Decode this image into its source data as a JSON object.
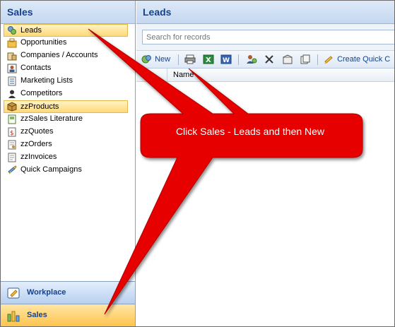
{
  "sidebar": {
    "title": "Sales",
    "items": [
      {
        "label": "Leads",
        "icon": "leads-icon",
        "selected": true
      },
      {
        "label": "Opportunities",
        "icon": "opportunities-icon",
        "selected": false
      },
      {
        "label": "Companies / Accounts",
        "icon": "accounts-icon",
        "selected": false
      },
      {
        "label": "Contacts",
        "icon": "contacts-icon",
        "selected": false
      },
      {
        "label": "Marketing Lists",
        "icon": "marketing-lists-icon",
        "selected": false
      },
      {
        "label": "Competitors",
        "icon": "competitors-icon",
        "selected": false
      },
      {
        "label": "zzProducts",
        "icon": "products-icon",
        "selected": true
      },
      {
        "label": "zzSales Literature",
        "icon": "sales-literature-icon",
        "selected": false
      },
      {
        "label": "zzQuotes",
        "icon": "quotes-icon",
        "selected": false
      },
      {
        "label": "zzOrders",
        "icon": "orders-icon",
        "selected": false
      },
      {
        "label": "zzInvoices",
        "icon": "invoices-icon",
        "selected": false
      },
      {
        "label": "Quick Campaigns",
        "icon": "quick-campaigns-icon",
        "selected": false
      }
    ],
    "wunderbar": {
      "workplace_label": "Workplace",
      "sales_label": "Sales"
    }
  },
  "main": {
    "title": "Leads",
    "search": {
      "placeholder": "Search for records",
      "value": ""
    },
    "toolbar": {
      "new_label": "New",
      "create_quick_label": "Create Quick C"
    },
    "grid": {
      "columns": [
        "Name"
      ]
    }
  },
  "callout": {
    "text": "Click Sales - Leads and then New",
    "color": "#ff0000"
  },
  "colors": {
    "header_text": "#15428b",
    "selection": "#ffd97a",
    "callout": "#e60000"
  }
}
